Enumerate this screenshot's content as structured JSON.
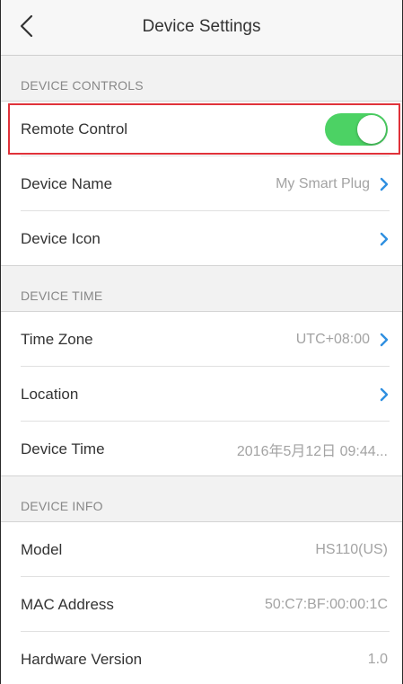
{
  "nav": {
    "title": "Device Settings",
    "back_icon": "chevron-left-icon"
  },
  "sections": {
    "controls": {
      "header": "DEVICE CONTROLS",
      "remote_control": {
        "label": "Remote Control",
        "enabled": true
      },
      "device_name": {
        "label": "Device Name",
        "value": "My Smart Plug"
      },
      "device_icon": {
        "label": "Device Icon"
      }
    },
    "time": {
      "header": "DEVICE TIME",
      "time_zone": {
        "label": "Time Zone",
        "value": "UTC+08:00"
      },
      "location": {
        "label": "Location"
      },
      "device_time": {
        "label": "Device Time",
        "value": "2016年5月12日   09:44..."
      }
    },
    "info": {
      "header": "DEVICE INFO",
      "model": {
        "label": "Model",
        "value": "HS110(US)"
      },
      "mac_address": {
        "label": "MAC Address",
        "value": "50:C7:BF:00:00:1C"
      },
      "hardware_version": {
        "label": "Hardware Version",
        "value": "1.0"
      }
    }
  },
  "colors": {
    "toggle_on": "#4cd264",
    "chevron": "#2f8fe0",
    "highlight": "#e0323a"
  }
}
